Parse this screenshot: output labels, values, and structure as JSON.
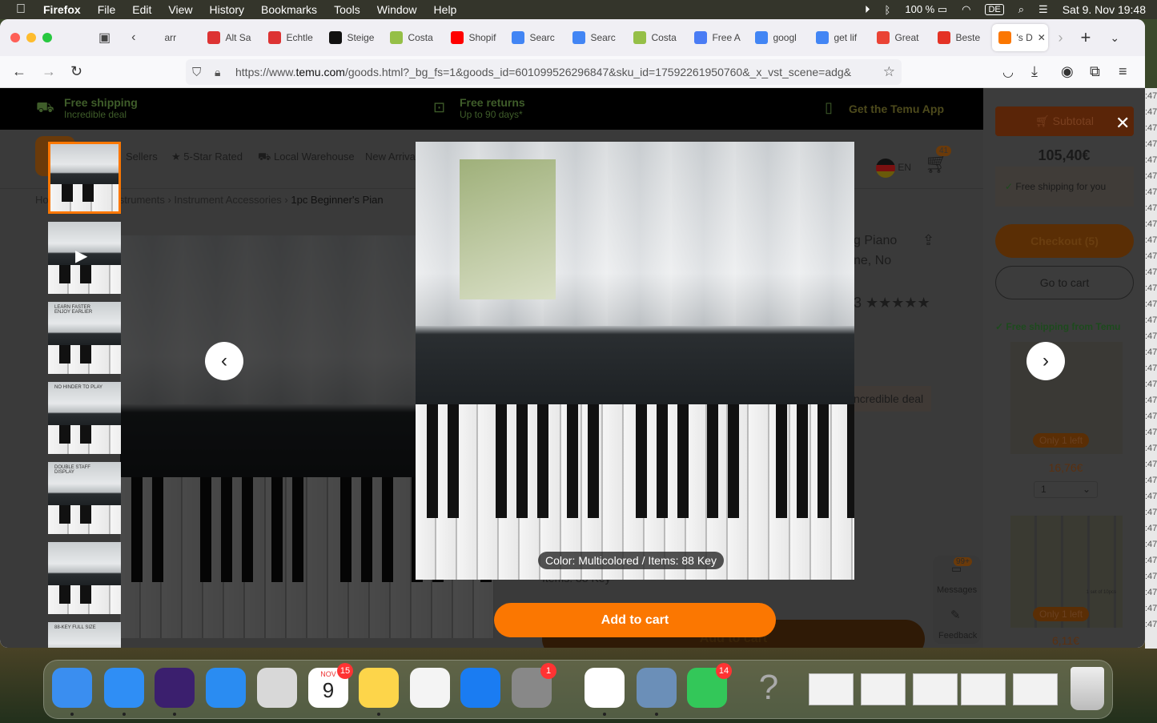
{
  "menubar": {
    "app": "Firefox",
    "menus": [
      "File",
      "Edit",
      "View",
      "History",
      "Bookmarks",
      "Tools",
      "Window",
      "Help"
    ],
    "battery": "100 %",
    "input_source": "DE",
    "datetime": "Sat 9. Nov  19:48"
  },
  "tabs": [
    {
      "label": "arr",
      "icon": "generic"
    },
    {
      "label": "Alt Sa",
      "icon": "bag-multicolor",
      "color": "#d33"
    },
    {
      "label": "Echtle",
      "icon": "bag-multicolor",
      "color": "#d33"
    },
    {
      "label": "Steige",
      "icon": "shopify-black",
      "color": "#111"
    },
    {
      "label": "Costa",
      "icon": "shopify",
      "color": "#95bf47"
    },
    {
      "label": "Shopif",
      "icon": "youtube",
      "color": "#f00"
    },
    {
      "label": "Searc",
      "icon": "google-ads",
      "color": "#4285f4"
    },
    {
      "label": "Searc",
      "icon": "google-ads",
      "color": "#4285f4"
    },
    {
      "label": "Costa",
      "icon": "shopify",
      "color": "#95bf47"
    },
    {
      "label": "Free A",
      "icon": "play",
      "color": "#4a7cf4"
    },
    {
      "label": "googl",
      "icon": "google",
      "color": "#4285f4"
    },
    {
      "label": "get lif",
      "icon": "google",
      "color": "#4285f4"
    },
    {
      "label": "Great",
      "icon": "gmail",
      "color": "#ea4335"
    },
    {
      "label": "Beste",
      "icon": "aliexpress",
      "color": "#e43225"
    },
    {
      "label": "'s D",
      "icon": "temu",
      "color": "#fb7701",
      "active": true
    }
  ],
  "url": {
    "prefix": "https://www.",
    "domain": "temu.com",
    "rest": "/goods.html?_bg_fs=1&goods_id=601099526296847&sku_id=17592261950760&_x_vst_scene=adg&"
  },
  "promo": [
    {
      "title": "Free shipping",
      "sub": "Incredible deal"
    },
    {
      "title": "Free returns",
      "sub": "Up to 90 days*"
    },
    {
      "title": "Get the Temu App",
      "sub": ""
    }
  ],
  "page": {
    "nav": [
      "Sellers",
      "5-Star Rated",
      "Local Warehouse",
      "New Arriva"
    ],
    "breadcrumb": [
      "Home",
      "Musical Instruments",
      "Instrument Accessories",
      "1pc Beginner's Pian"
    ],
    "title_frag1": "g Piano",
    "title_frag2": "ne, No",
    "rating_frag": "3 ★★★★★",
    "deal": "ncredible deal",
    "items_frag": "Items: 88 Key",
    "add_to_cart_bg": "Add to cart",
    "lang": "EN",
    "cart_count": "41",
    "messages": "Messages",
    "messages_badge": "99+",
    "feedback": "Feedback"
  },
  "cart": {
    "subtotal": "Subtotal",
    "count": "41",
    "total": "105,40€",
    "free_shipping": "Free shipping for you",
    "checkout": "Checkout (5)",
    "go_to_cart": "Go to cart",
    "free_from": "Free shipping from Temu",
    "items": [
      {
        "stock": "Only 1 left",
        "price": "16,76€",
        "qty": "1"
      },
      {
        "stock": "Only 1 left",
        "price": "6,11€",
        "label": "1 set of 10pcs"
      }
    ]
  },
  "modal": {
    "caption": "Color: Multicolored / Items: 88 Key",
    "add_to_cart": "Add to cart",
    "accent": "#fb7701",
    "thumbnails": [
      {
        "text": ""
      },
      {
        "text": "",
        "video": true
      },
      {
        "text": "LEARN FASTER ENJOY EARLIER"
      },
      {
        "text": "NO HINDER TO PLAY"
      },
      {
        "text": "DOUBLE STAFF DISPLAY"
      },
      {
        "text": ""
      },
      {
        "text": "88-KEY FULL SIZE"
      }
    ]
  },
  "dock": [
    {
      "name": "finder",
      "color": "#3a8ef0",
      "running": true
    },
    {
      "name": "safari",
      "color": "#2f8ef5",
      "running": true
    },
    {
      "name": "firefox",
      "color": "#3b1f6e",
      "running": true
    },
    {
      "name": "mail",
      "color": "#2a8cf2"
    },
    {
      "name": "no-entry",
      "color": "#d8d8d8"
    },
    {
      "name": "calendar",
      "color": "#fff",
      "badge": "15",
      "month": "NOV",
      "day": "9"
    },
    {
      "name": "notes",
      "color": "#fdd54a",
      "running": true
    },
    {
      "name": "freeform",
      "color": "#f4f4f4"
    },
    {
      "name": "app-store",
      "color": "#1a7cf2"
    },
    {
      "name": "system-settings",
      "color": "#888",
      "badge": "1"
    },
    {
      "name": "powerpoint",
      "color": "#fff",
      "running": true
    },
    {
      "name": "preview",
      "color": "#6b8fb8",
      "running": true
    },
    {
      "name": "facetime",
      "color": "#33c759",
      "badge": "14"
    },
    {
      "name": "help",
      "color": "transparent"
    }
  ],
  "rightstrip": ":47"
}
